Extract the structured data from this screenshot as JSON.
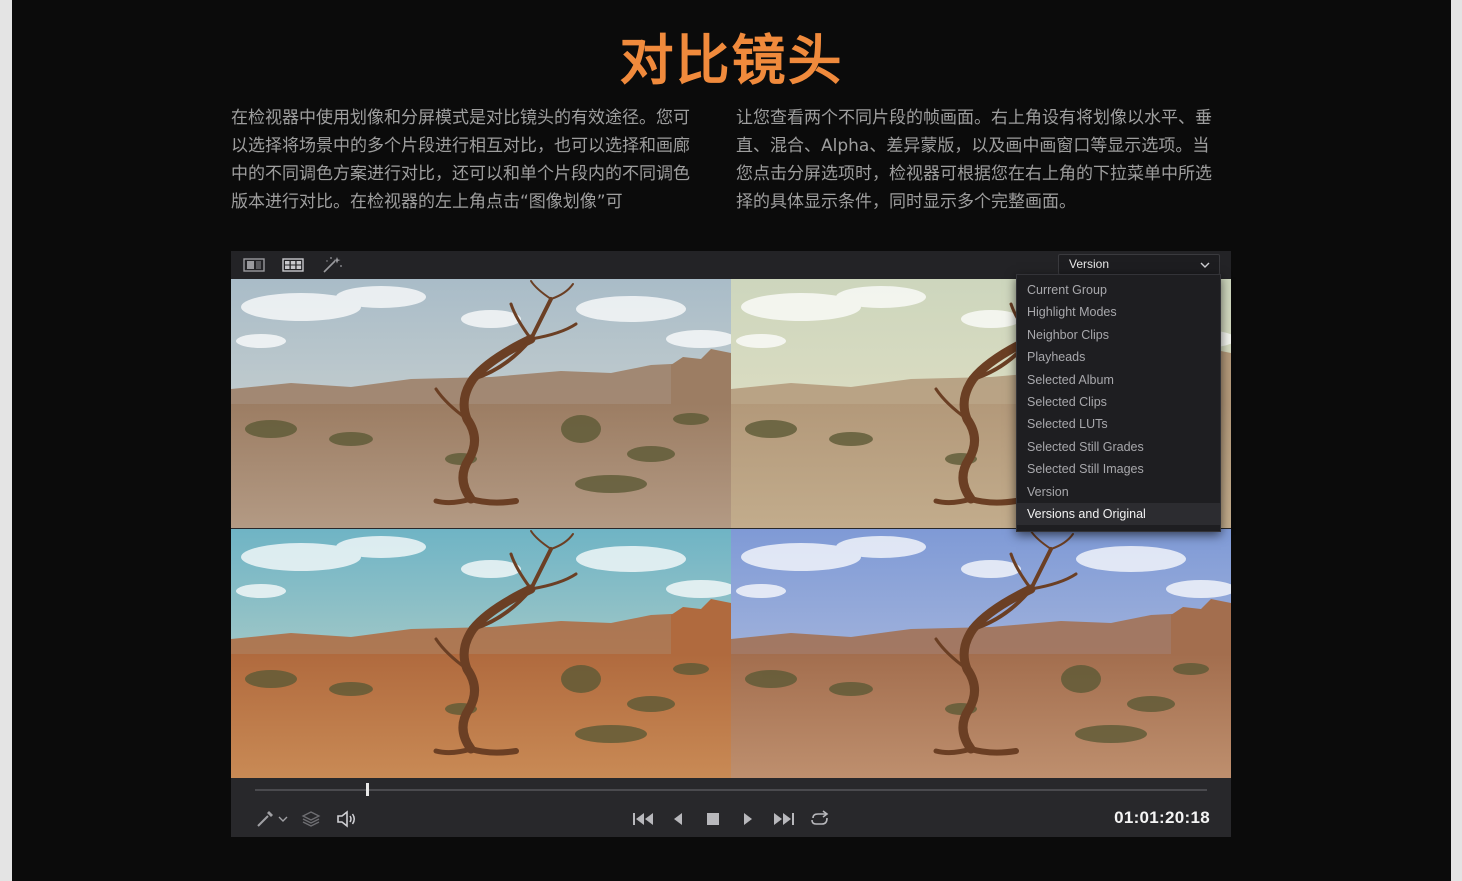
{
  "header": {
    "title": "对比镜头",
    "paragraph_left": "在检视器中使用划像和分屏模式是对比镜头的有效途径。您可以选择将场景中的多个片段进行相互对比，也可以选择和画廊中的不同调色方案进行对比，还可以和单个片段内的不同调色版本进行对比。在检视器的左上角点击“图像划像”可",
    "paragraph_right": "让您查看两个不同片段的帧画面。右上角设有将划像以水平、垂直、混合、Alpha、差异蒙版，以及画中画窗口等显示选项。当您点击分屏选项时，检视器可根据您在右上角的下拉菜单中所选择的具体显示条件，同时显示多个完整画面。"
  },
  "viewer": {
    "topbar": {
      "icons": [
        "image-wipe-icon",
        "split-screen-icon",
        "magic-wand-icon"
      ],
      "select_value": "Version"
    },
    "dropdown": {
      "items": [
        "Current Group",
        "Highlight Modes",
        "Neighbor Clips",
        "Playheads",
        "Selected Album",
        "Selected Clips",
        "Selected LUTs",
        "Selected Still Grades",
        "Selected Still Images",
        "Version",
        "Versions and Original"
      ],
      "selected": "Versions and Original"
    },
    "grades": {
      "q1": {
        "sky_top": "#a9bcc8",
        "sky_bottom": "#d9dbd3",
        "land": "#9c7d63",
        "ground": "#b39a84"
      },
      "q2": {
        "sky_top": "#cdd6bd",
        "sky_bottom": "#e8e2c6",
        "land": "#b3997a",
        "ground": "#c2ac8c"
      },
      "q3": {
        "sky_top": "#6fb4c5",
        "sky_bottom": "#cfd9c9",
        "land": "#b06a3e",
        "ground": "#c98a55"
      },
      "q4": {
        "sky_top": "#7f9ad6",
        "sky_bottom": "#bfc8e0",
        "land": "#a36e4e",
        "ground": "#be8f6e"
      }
    },
    "transport": {
      "timecode": "01:01:20:18",
      "playhead_fraction": 0.117
    },
    "colors": {
      "accent": "#f08a3c",
      "panel": "#28282b"
    }
  }
}
